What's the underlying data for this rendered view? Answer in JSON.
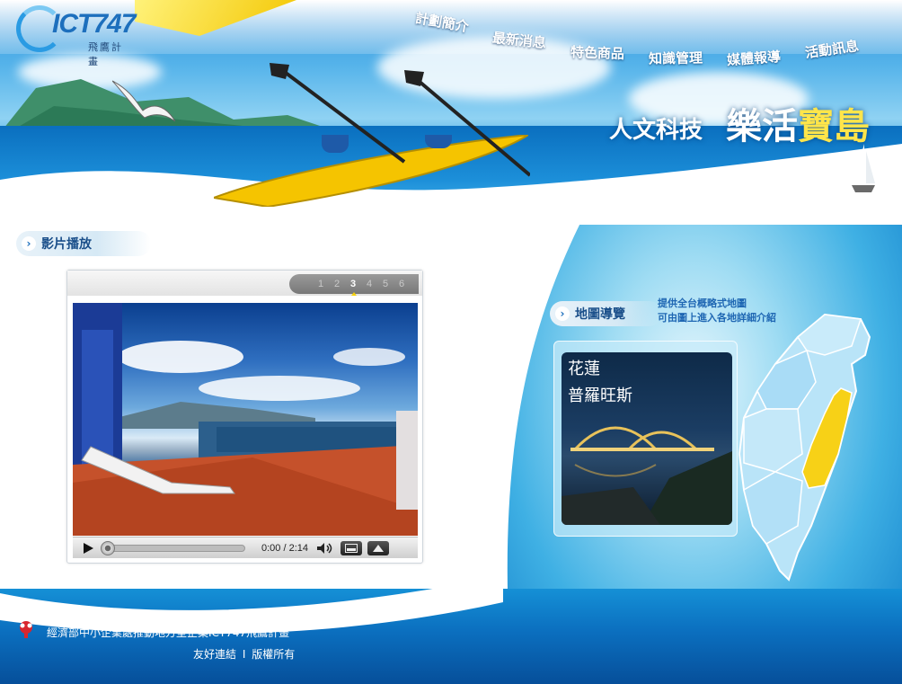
{
  "logo": {
    "text": "ICT747",
    "subtitle": "飛鷹計畫"
  },
  "nav": {
    "items": [
      "計劃簡介",
      "最新消息",
      "特色商品",
      "知識管理",
      "媒體報導",
      "活動訊息"
    ]
  },
  "banner": {
    "slogan_part1": "人文科技",
    "slogan_part2_white": "樂活",
    "slogan_part2_gold": "寶島"
  },
  "video_section": {
    "title": "影片播放",
    "pager": [
      "1",
      "2",
      "3",
      "4",
      "5",
      "6"
    ],
    "active_page": "3",
    "time_display": "0:00 / 2:14"
  },
  "map_section": {
    "title": "地圖導覽",
    "desc_line1": "提供全台概略式地圖",
    "desc_line2": "可由圖上進入各地詳細介紹",
    "card_city": "花蓮",
    "card_place": "普羅旺斯",
    "highlight_color": "#f7d117"
  },
  "footer": {
    "org_text": "經濟部中小企業處推動地方型企業ICT747飛鷹計畫",
    "link_friends": "友好連結",
    "separator": "I",
    "link_copyright": "版權所有"
  },
  "colors": {
    "brand_blue": "#1d6fbd",
    "accent_yellow": "#f5d10a"
  }
}
